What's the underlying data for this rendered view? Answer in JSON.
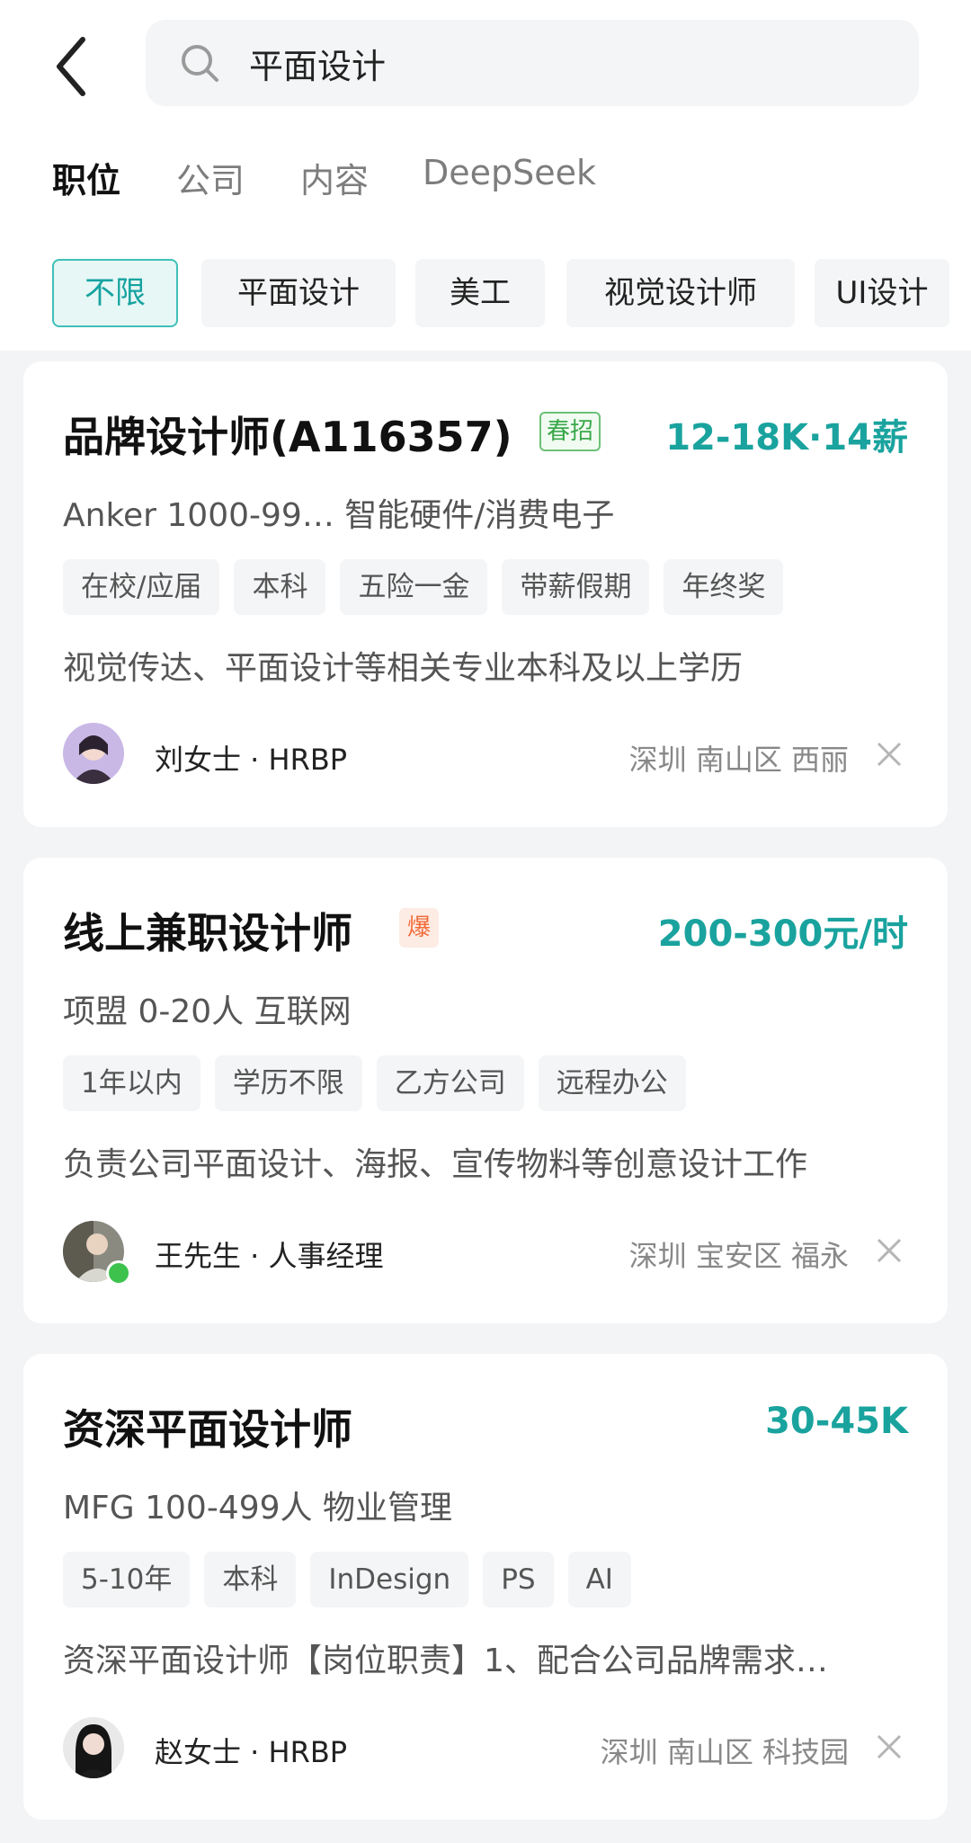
{
  "search": {
    "value": "平面设计"
  },
  "tabs": [
    "职位",
    "公司",
    "内容",
    "DeepSeek"
  ],
  "chips": [
    "不限",
    "平面设计",
    "美工",
    "视觉设计师",
    "UI设计"
  ],
  "jobs": [
    {
      "title": "品牌设计师(A116357)",
      "badge": "春招",
      "salary": "12-18K·14薪",
      "company": "Anker  1000-99…  智能硬件/消费电子",
      "tags": [
        "在校/应届",
        "本科",
        "五险一金",
        "带薪假期",
        "年终奖"
      ],
      "desc": "视觉传达、平面设计等相关专业本科及以上学历",
      "recruiter": "刘女士 · HRBP",
      "location": "深圳  南山区  西丽"
    },
    {
      "title": "线上兼职设计师",
      "badge": "爆",
      "salary": "200-300元/时",
      "company": "项盟  0-20人  互联网",
      "tags": [
        "1年以内",
        "学历不限",
        "乙方公司",
        "远程办公"
      ],
      "desc": "负责公司平面设计、海报、宣传物料等创意设计工作",
      "recruiter": "王先生 · 人事经理",
      "location": "深圳  宝安区  福永"
    },
    {
      "title": "资深平面设计师",
      "salary": "30-45K",
      "company": "MFG  100-499人  物业管理",
      "tags": [
        "5-10年",
        "本科",
        "InDesign",
        "PS",
        "AI"
      ],
      "desc": "资深平面设计师【岗位职责】1、配合公司品牌需求…",
      "recruiter": "赵女士 · HRBP",
      "location": "深圳  南山区  科技园"
    }
  ],
  "colors": {
    "accent": "#1aa39e",
    "chip_active_bg": "#e6f7f5",
    "page_bg": "#f3f4f6"
  }
}
